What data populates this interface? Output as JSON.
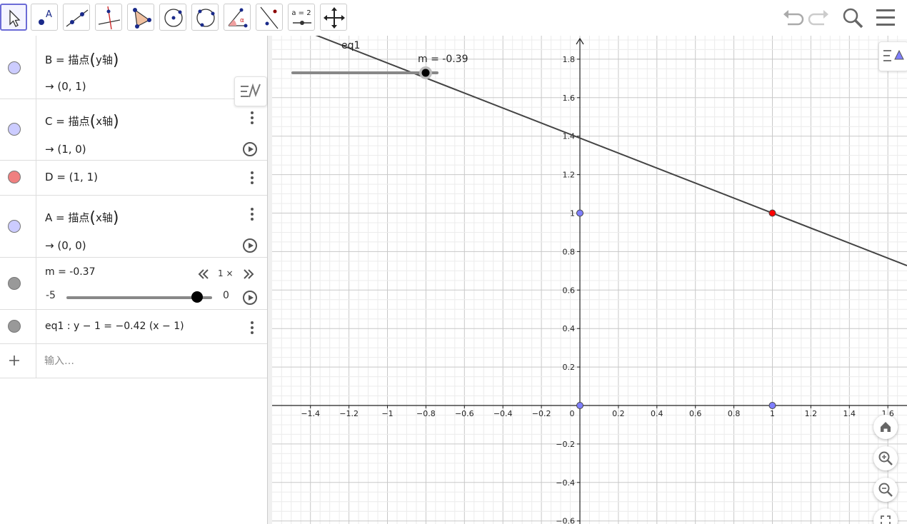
{
  "toolbar": {
    "tools": [
      "move-tool",
      "point-tool",
      "line-tool",
      "perpendicular-tool",
      "polygon-tool",
      "circle-center-tool",
      "circle-three-points-tool",
      "angle-tool",
      "reflect-tool",
      "slider-tool",
      "move-graphics-tool"
    ],
    "slider_tool_label": "a = 2",
    "angle_tool_glyph": "α",
    "undo_icon": "undo-icon",
    "redo_icon": "redo-icon",
    "search_icon": "search-icon",
    "menu_icon": "menu-icon"
  },
  "algebra": {
    "rows": [
      {
        "name": "B",
        "def": "B = 描点",
        "arg": "y轴",
        "result": "→ (0, 1)",
        "color": "#ccccff"
      },
      {
        "name": "C",
        "def": "C = 描点",
        "arg": "x轴",
        "result": "→ (1, 0)",
        "color": "#ccccff"
      },
      {
        "name": "D",
        "def": "D = (1, 1)",
        "color": "#f08080"
      },
      {
        "name": "A",
        "def": "A = 描点",
        "arg": "x轴",
        "result": "→ (0, 0)",
        "color": "#ccccff"
      },
      {
        "name": "m",
        "def": "m = -0.37",
        "speed": "1 ×",
        "min": "-5",
        "max": "0",
        "value": -0.37,
        "color": "#999999"
      },
      {
        "name": "eq1",
        "def": "eq1 : y − 1 = −0.42 (x − 1)",
        "color": "#999999"
      }
    ],
    "input_placeholder": "输入…",
    "add_icon": "plus-icon"
  },
  "graphics": {
    "slider_label": "m = -0.39",
    "line_label": "eq1",
    "x_ticks": [
      "−1.4",
      "−1.2",
      "−1",
      "−0.8",
      "−0.6",
      "−0.4",
      "−0.2",
      "0",
      "0.2",
      "0.4",
      "0.6",
      "0.8",
      "1",
      "1.2",
      "1.4",
      "1.6"
    ],
    "y_ticks": [
      "1.8",
      "1.6",
      "1.4",
      "1.2",
      "1",
      "0.8",
      "0.6",
      "0.4",
      "0.2",
      "−0.2",
      "−0.4",
      "−0.6"
    ],
    "points": [
      {
        "name": "B",
        "x": 0,
        "y": 1,
        "color": "#7f7fff"
      },
      {
        "name": "A",
        "x": 0,
        "y": 0,
        "color": "#7f7fff"
      },
      {
        "name": "C",
        "x": 1,
        "y": 0,
        "color": "#7f7fff"
      },
      {
        "name": "D",
        "x": 1,
        "y": 1,
        "color": "#ff0000"
      }
    ],
    "line": {
      "slope": -0.39,
      "point": [
        1,
        1
      ]
    }
  },
  "colors": {
    "accent": "#6b6bd6",
    "free_point": "#7f7fff",
    "dependent_point": "#ff0000",
    "line": "#444444"
  }
}
